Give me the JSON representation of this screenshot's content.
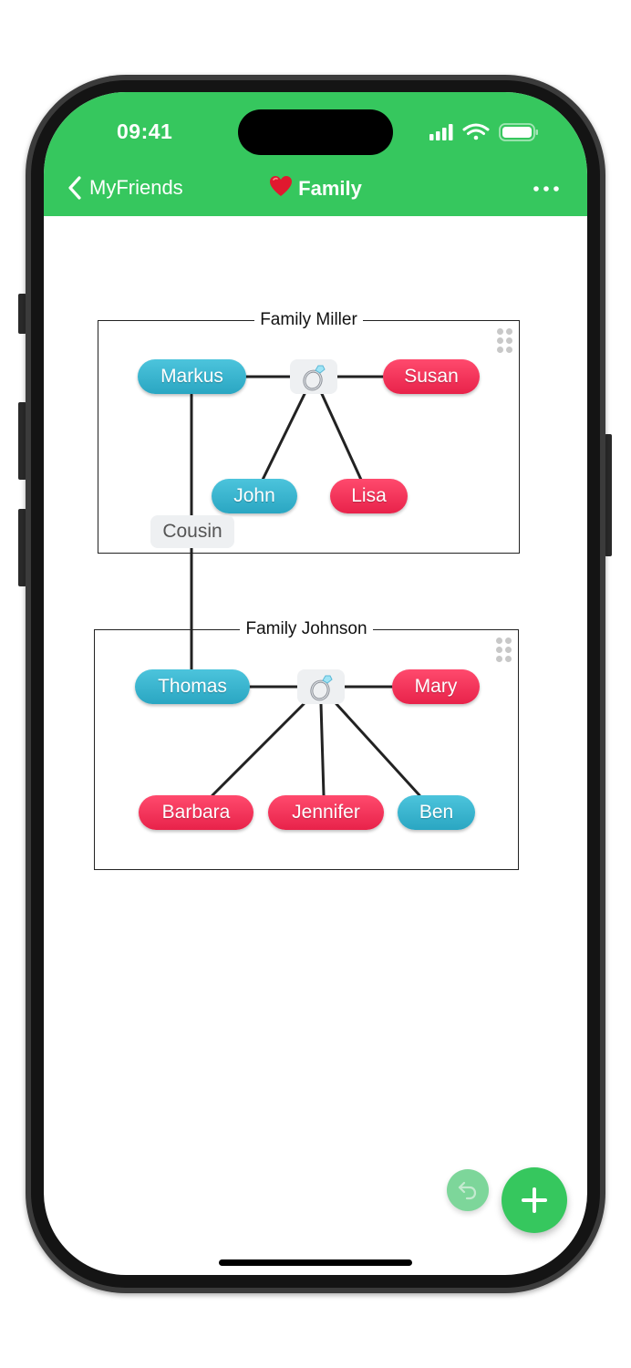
{
  "status_bar": {
    "time": "09:41",
    "icons": [
      "cellular-signal-icon",
      "wifi-icon",
      "battery-icon"
    ]
  },
  "nav_bar": {
    "back_label": "MyFriends",
    "title_emoji": "heart-emoji",
    "title": "Family",
    "more_icon": "ellipsis-icon",
    "accent_color": "#36c75e"
  },
  "groups": [
    {
      "title": "Family Miller",
      "members": [
        {
          "name": "Markus",
          "gender": "male"
        },
        {
          "name": "Susan",
          "gender": "female"
        },
        {
          "name": "John",
          "gender": "male"
        },
        {
          "name": "Lisa",
          "gender": "female"
        }
      ],
      "marriage": {
        "icon": "ring-icon",
        "partners": [
          "Markus",
          "Susan"
        ],
        "children": [
          "John",
          "Lisa"
        ]
      }
    },
    {
      "title": "Family Johnson",
      "members": [
        {
          "name": "Thomas",
          "gender": "male"
        },
        {
          "name": "Mary",
          "gender": "female"
        },
        {
          "name": "Barbara",
          "gender": "female"
        },
        {
          "name": "Jennifer",
          "gender": "female"
        },
        {
          "name": "Ben",
          "gender": "male"
        }
      ],
      "marriage": {
        "icon": "ring-icon",
        "partners": [
          "Thomas",
          "Mary"
        ],
        "children": [
          "Barbara",
          "Jennifer",
          "Ben"
        ]
      }
    }
  ],
  "relations": [
    {
      "from": "Markus",
      "to": "Thomas",
      "label": "Cousin"
    }
  ],
  "colors": {
    "male": "#35b3cf",
    "female": "#f5335a",
    "connector": "#222222"
  },
  "actions": {
    "undo_icon": "undo-icon",
    "add_icon": "plus-icon"
  }
}
